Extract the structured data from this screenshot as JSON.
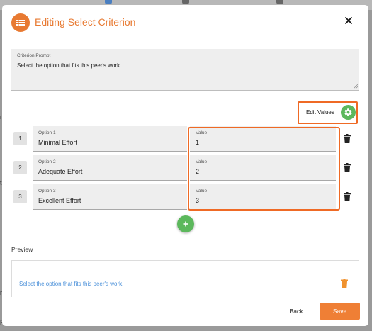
{
  "background": {
    "left_fragments": [
      "nt",
      "t",
      "r",
      "P"
    ]
  },
  "dialog": {
    "title": "Editing Select Criterion",
    "header_icon": "list-icon",
    "close_icon": "close-icon"
  },
  "prompt": {
    "label": "Criterion Prompt",
    "text": "Select the option that fits this peer's work."
  },
  "edit_values": {
    "label": "Edit Values",
    "icon": "gear-icon"
  },
  "options": [
    {
      "num": "1",
      "option_label": "Option 1",
      "option_text": "Minimal Effort",
      "value_label": "Value",
      "value": "1"
    },
    {
      "num": "2",
      "option_label": "Option 2",
      "option_text": "Adequate Effort",
      "value_label": "Value",
      "value": "2"
    },
    {
      "num": "3",
      "option_label": "Option 3",
      "option_text": "Excellent Effort",
      "value_label": "Value",
      "value": "3"
    }
  ],
  "add_icon": "plus-icon",
  "preview": {
    "label": "Preview",
    "text": "Select the option that fits this peer's work."
  },
  "footer": {
    "back_label": "Back",
    "save_label": "Save"
  },
  "colors": {
    "accent": "#e87a32",
    "highlight": "#ef6a25",
    "green": "#5cb85c",
    "link": "#4a90d9"
  }
}
